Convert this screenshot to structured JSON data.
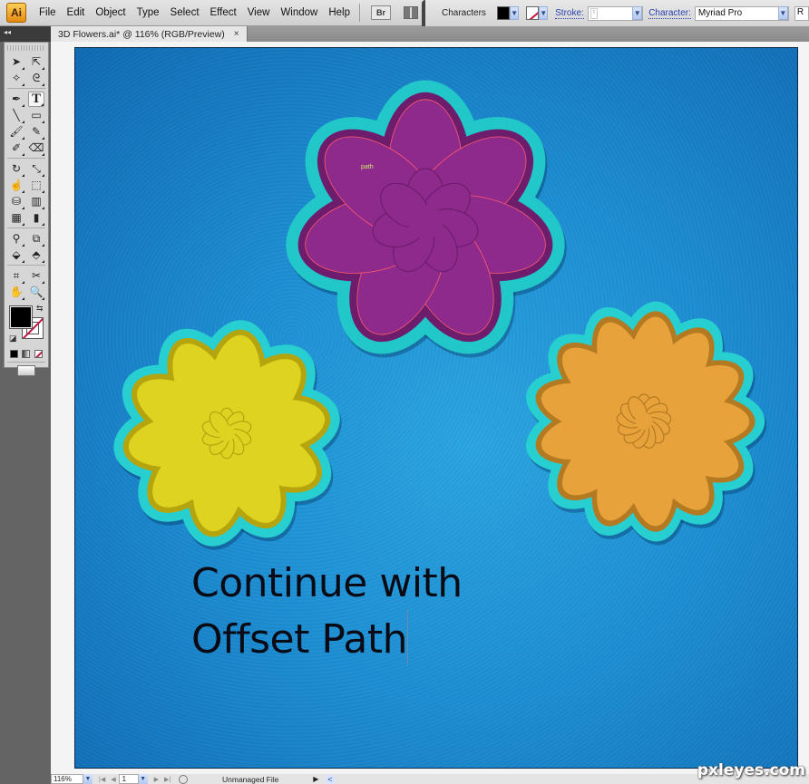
{
  "app": {
    "logo": "Ai",
    "menu": [
      "File",
      "Edit",
      "Object",
      "Type",
      "Select",
      "Effect",
      "View",
      "Window",
      "Help"
    ],
    "bridge_label": "Br",
    "icons": {
      "bridge": "bridge-icon",
      "arrange": "arrange-documents-icon"
    }
  },
  "control_panel": {
    "label": "Characters",
    "fill_color": "#000000",
    "stroke_color": "none",
    "stroke_label": "Stroke:",
    "stroke_value": "",
    "character_label": "Character:",
    "font_family": "Myriad Pro",
    "font_style": "R"
  },
  "document": {
    "tab_title": "3D Flowers.ai* @ 116% (RGB/Preview)",
    "tab_close": "×"
  },
  "tools": {
    "rows": [
      [
        {
          "name": "selection-tool",
          "glyph": "➤"
        },
        {
          "name": "direct-selection-tool",
          "glyph": "⇱"
        }
      ],
      [
        {
          "name": "magic-wand-tool",
          "glyph": "✧"
        },
        {
          "name": "lasso-tool",
          "glyph": "ᘓ"
        }
      ],
      [
        {
          "name": "pen-tool",
          "glyph": "✒"
        },
        {
          "name": "type-tool",
          "glyph": "T",
          "active": true
        }
      ],
      [
        {
          "name": "line-segment-tool",
          "glyph": "╲"
        },
        {
          "name": "rectangle-tool",
          "glyph": "▭"
        }
      ],
      [
        {
          "name": "paintbrush-tool",
          "glyph": "🖌"
        },
        {
          "name": "pencil-tool",
          "glyph": "✎"
        }
      ],
      [
        {
          "name": "blob-brush-tool",
          "glyph": "✐"
        },
        {
          "name": "eraser-tool",
          "glyph": "⌫"
        }
      ],
      [
        {
          "name": "rotate-tool",
          "glyph": "↻"
        },
        {
          "name": "scale-tool",
          "glyph": "⤡"
        }
      ],
      [
        {
          "name": "warp-tool",
          "glyph": "☝"
        },
        {
          "name": "free-transform-tool",
          "glyph": "⬚"
        }
      ],
      [
        {
          "name": "symbol-sprayer-tool",
          "glyph": "⛁"
        },
        {
          "name": "column-graph-tool",
          "glyph": "▥"
        }
      ],
      [
        {
          "name": "mesh-tool",
          "glyph": "▦"
        },
        {
          "name": "gradient-tool",
          "glyph": "▮"
        }
      ],
      [
        {
          "name": "eyedropper-tool",
          "glyph": "⚲"
        },
        {
          "name": "blend-tool",
          "glyph": "⧉"
        }
      ],
      [
        {
          "name": "live-paint-bucket-tool",
          "glyph": "⬙"
        },
        {
          "name": "live-paint-selection-tool",
          "glyph": "⬘"
        }
      ],
      [
        {
          "name": "artboard-tool",
          "glyph": "⌗"
        },
        {
          "name": "slice-tool",
          "glyph": "✂"
        }
      ],
      [
        {
          "name": "hand-tool",
          "glyph": "✋"
        },
        {
          "name": "zoom-tool",
          "glyph": "🔍"
        }
      ]
    ],
    "fill": "#000000",
    "stroke": "none",
    "swap_glyph": "⇆",
    "default_glyph": "◪"
  },
  "artwork": {
    "flowers": [
      {
        "name": "purple-flower",
        "petals": 7,
        "petal_color": "#8e2a8c",
        "shadow_color": "#6d1d6c",
        "outline_color": "#22c7c9",
        "selected": true
      },
      {
        "name": "yellow-flower",
        "petals": 10,
        "petal_color": "#dfd321",
        "shadow_color": "#b6a40f",
        "outline_color": "#27cfd1",
        "selected": false
      },
      {
        "name": "orange-flower",
        "petals": 13,
        "petal_color": "#e8a23b",
        "shadow_color": "#b47a22",
        "outline_color": "#27cfd1",
        "selected": false
      }
    ],
    "hover_label": "path",
    "text_lines": [
      "Continue with",
      "Offset Path"
    ]
  },
  "status_bar": {
    "zoom": "116%",
    "artboard_number": "1",
    "status_text": "Unmanaged File"
  },
  "watermark": "pxleyes.com"
}
